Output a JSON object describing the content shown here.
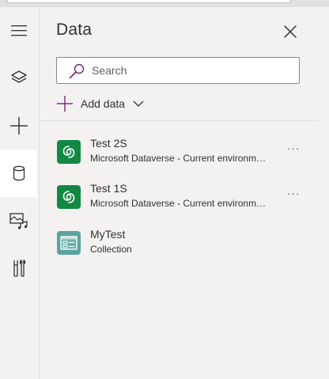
{
  "panel": {
    "title": "Data",
    "close_icon": "close-icon"
  },
  "search": {
    "placeholder": "Search",
    "value": "",
    "icon": "search-icon"
  },
  "add_data": {
    "label": "Add data",
    "icon": "plus-icon",
    "chevron": "chevron-down-icon"
  },
  "rail": {
    "items": [
      {
        "name": "menu",
        "icon": "hamburger-icon",
        "active": false
      },
      {
        "name": "tree-view",
        "icon": "layers-icon",
        "active": false
      },
      {
        "name": "insert",
        "icon": "plus-icon",
        "active": false
      },
      {
        "name": "data",
        "icon": "database-icon",
        "active": true
      },
      {
        "name": "media",
        "icon": "media-icon",
        "active": false
      },
      {
        "name": "tools",
        "icon": "tools-icon",
        "active": false
      }
    ]
  },
  "data_sources": [
    {
      "name": "Test 2S",
      "subtitle": "Microsoft Dataverse - Current environment",
      "icon": "dataverse-icon",
      "more": "···"
    },
    {
      "name": "Test 1S",
      "subtitle": "Microsoft Dataverse - Current environment",
      "icon": "dataverse-icon",
      "more": "···"
    },
    {
      "name": "MyTest",
      "subtitle": "Collection",
      "icon": "collection-icon"
    }
  ],
  "colors": {
    "accent": "#742774",
    "dataverse_green": "#138844",
    "collection_teal": "#5aa3a1",
    "panel_bg": "#f3f2f1"
  }
}
